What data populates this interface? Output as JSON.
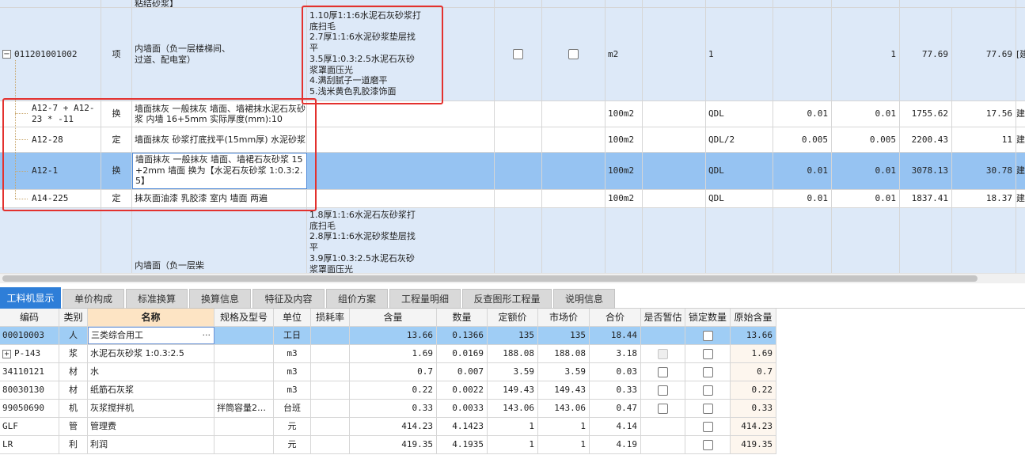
{
  "top_rows": {
    "prev": {
      "partial_text": "粘结砂浆】"
    },
    "item1": {
      "code": "011201001002",
      "type": "项",
      "name": "内墙面（负一层楼梯间、过道、配电室）",
      "features": [
        "1.10厚1:1:6水泥石灰砂浆打底扫毛",
        "2.7厚1:1:6水泥砂浆垫层找平",
        "3.5厚1:0.3:2.5水泥石灰砂浆罩面压光",
        "4.满刮腻子一道磨平",
        "5.浅米黄色乳胶漆饰面"
      ],
      "unit": "m2",
      "qty_expr": "1",
      "qty": "1",
      "unit_price": "77.69",
      "total": "77.69",
      "tail": "[建"
    },
    "sub": [
      {
        "code": "A12-7 + A12-23 * -11",
        "type": "换",
        "name": "墙面抹灰 一般抹灰 墙面、墙裙抹水泥石灰砂浆 内墙 16+5mm 实际厚度(mm):10",
        "unit": "100m2",
        "expr": "QDL",
        "coef": "0.01",
        "qty": "0.01",
        "price": "1755.62",
        "total": "17.56",
        "tail": "建"
      },
      {
        "code": "A12-28",
        "type": "定",
        "name": "墙面抹灰 砂浆打底找平(15mm厚) 水泥砂浆",
        "unit": "100m2",
        "expr": "QDL/2",
        "coef": "0.005",
        "qty": "0.005",
        "price": "2200.43",
        "total": "11",
        "tail": "建"
      },
      {
        "code": "A12-1",
        "type": "换",
        "name": "墙面抹灰 一般抹灰 墙面、墙裙石灰砂浆 15+2mm 墙面 换为【水泥石灰砂浆 1:0.3:2.5】",
        "unit": "100m2",
        "expr": "QDL",
        "coef": "0.01",
        "qty": "0.01",
        "price": "3078.13",
        "total": "30.78",
        "tail": "建"
      },
      {
        "code": "A14-225",
        "type": "定",
        "name": "抹灰面油漆 乳胶漆 室内 墙面 两遍",
        "unit": "100m2",
        "expr": "QDL",
        "coef": "0.01",
        "qty": "0.01",
        "price": "1837.41",
        "total": "18.37",
        "tail": "建"
      }
    ],
    "item2": {
      "name": "内墙面（负一层柴",
      "features": [
        "1.8厚1:1:6水泥石灰砂浆打底扫毛",
        "2.8厚1:1:6水泥砂浆垫层找平",
        "3.9厚1:0.3:2.5水泥石灰砂浆罩面压光"
      ]
    }
  },
  "tabs": [
    {
      "label": "工料机显示",
      "active": true
    },
    {
      "label": "单价构成"
    },
    {
      "label": "标准换算"
    },
    {
      "label": "换算信息"
    },
    {
      "label": "特征及内容"
    },
    {
      "label": "组价方案"
    },
    {
      "label": "工程量明细"
    },
    {
      "label": "反查图形工程量"
    },
    {
      "label": "说明信息"
    }
  ],
  "material_table": {
    "headers": {
      "code": "编码",
      "category": "类别",
      "name": "名称",
      "spec": "规格及型号",
      "unit": "单位",
      "loss": "损耗率",
      "content": "含量",
      "qty": "数量",
      "quota_price": "定额价",
      "market_price": "市场价",
      "total": "合价",
      "provisional": "是否暂估",
      "lock_qty": "锁定数量",
      "orig_content": "原始含量"
    },
    "rows": [
      {
        "code": "00010003",
        "category": "人",
        "name": "三类综合用工",
        "spec": "",
        "unit": "工日",
        "content": "13.66",
        "qty": "0.1366",
        "quota_price": "135",
        "market_price": "135",
        "total": "18.44",
        "orig": "13.66"
      },
      {
        "code": "P-143",
        "category": "浆",
        "name": "水泥石灰砂浆 1:0.3:2.5",
        "spec": "",
        "unit": "m3",
        "content": "1.69",
        "qty": "0.0169",
        "quota_price": "188.08",
        "market_price": "188.08",
        "total": "3.18",
        "orig": "1.69"
      },
      {
        "code": "34110121",
        "category": "材",
        "name": "水",
        "spec": "",
        "unit": "m3",
        "content": "0.7",
        "qty": "0.007",
        "quota_price": "3.59",
        "market_price": "3.59",
        "total": "0.03",
        "orig": "0.7"
      },
      {
        "code": "80030130",
        "category": "材",
        "name": "纸筋石灰浆",
        "spec": "",
        "unit": "m3",
        "content": "0.22",
        "qty": "0.0022",
        "quota_price": "149.43",
        "market_price": "149.43",
        "total": "0.33",
        "orig": "0.22"
      },
      {
        "code": "99050690",
        "category": "机",
        "name": "灰浆搅拌机",
        "spec": "拌筒容量2…",
        "unit": "台班",
        "content": "0.33",
        "qty": "0.0033",
        "quota_price": "143.06",
        "market_price": "143.06",
        "total": "0.47",
        "orig": "0.33"
      },
      {
        "code": "GLF",
        "category": "管",
        "name": "管理费",
        "spec": "",
        "unit": "元",
        "content": "414.23",
        "qty": "4.1423",
        "quota_price": "1",
        "market_price": "1",
        "total": "4.14",
        "orig": "414.23"
      },
      {
        "code": "LR",
        "category": "利",
        "name": "利润",
        "spec": "",
        "unit": "元",
        "content": "419.35",
        "qty": "4.1935",
        "quota_price": "1",
        "market_price": "1",
        "total": "4.19",
        "orig": "419.35"
      }
    ]
  }
}
